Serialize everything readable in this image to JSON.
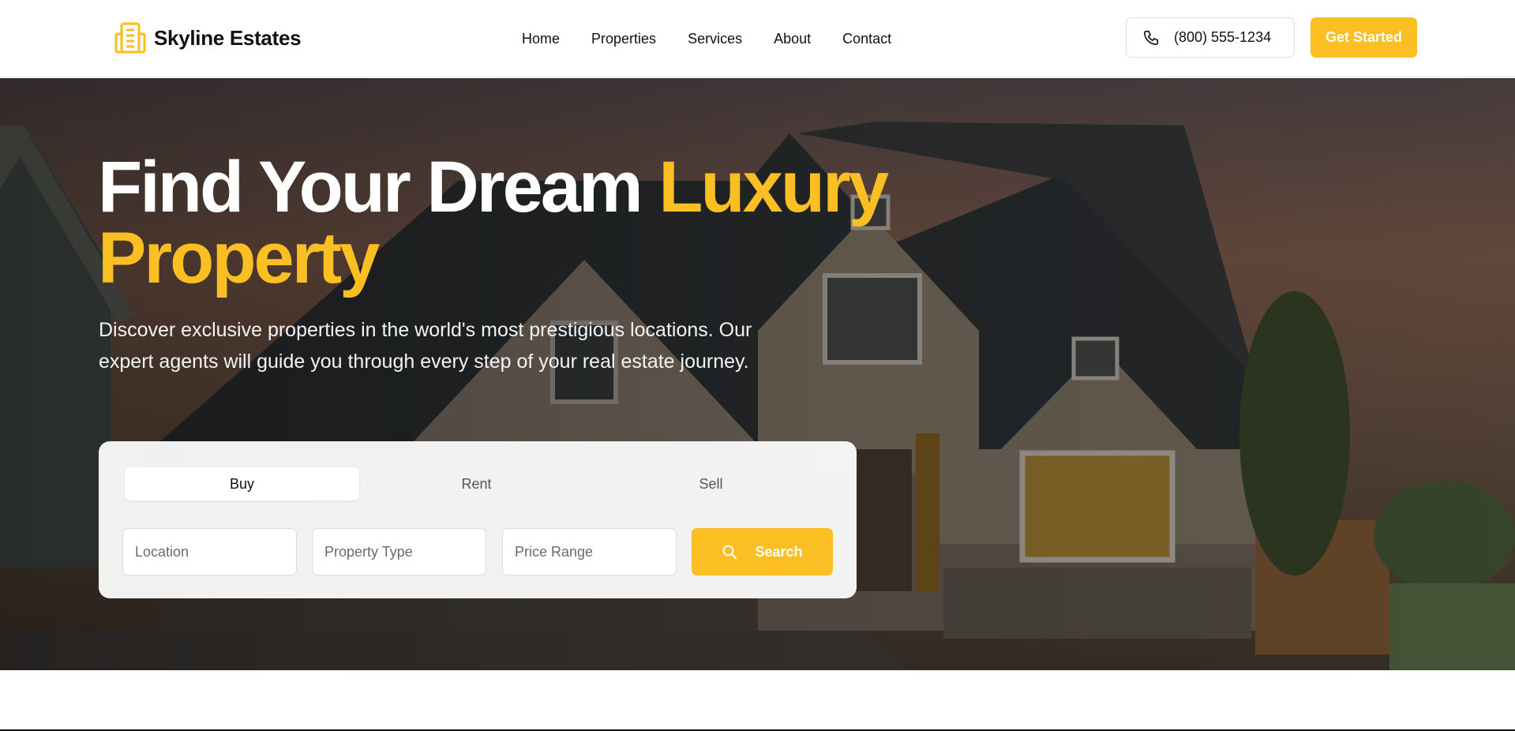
{
  "brand": {
    "name": "Skyline Estates",
    "icon": "building-icon",
    "color": "#fbbf24"
  },
  "nav": {
    "items": [
      {
        "label": "Home"
      },
      {
        "label": "Properties"
      },
      {
        "label": "Services"
      },
      {
        "label": "About"
      },
      {
        "label": "Contact"
      }
    ]
  },
  "header": {
    "phone": {
      "icon": "phone-icon",
      "label": "(800) 555-1234"
    },
    "cta_label": "Get Started"
  },
  "hero": {
    "title_main": "Find Your Dream ",
    "title_accent": "Luxury Property",
    "subtitle": "Discover exclusive properties in the world's most prestigious locations. Our expert agents will guide you through every step of your real estate journey.",
    "background": "house-at-dusk-photo"
  },
  "search": {
    "tabs": [
      {
        "label": "Buy",
        "active": true
      },
      {
        "label": "Rent",
        "active": false
      },
      {
        "label": "Sell",
        "active": false
      }
    ],
    "location_placeholder": "Location",
    "type_placeholder": "Property Type",
    "price_placeholder": "Price Range",
    "button_label": "Search",
    "button_icon": "search-icon"
  },
  "colors": {
    "accent": "#fbbf24",
    "text": "#111111",
    "white": "#ffffff"
  }
}
